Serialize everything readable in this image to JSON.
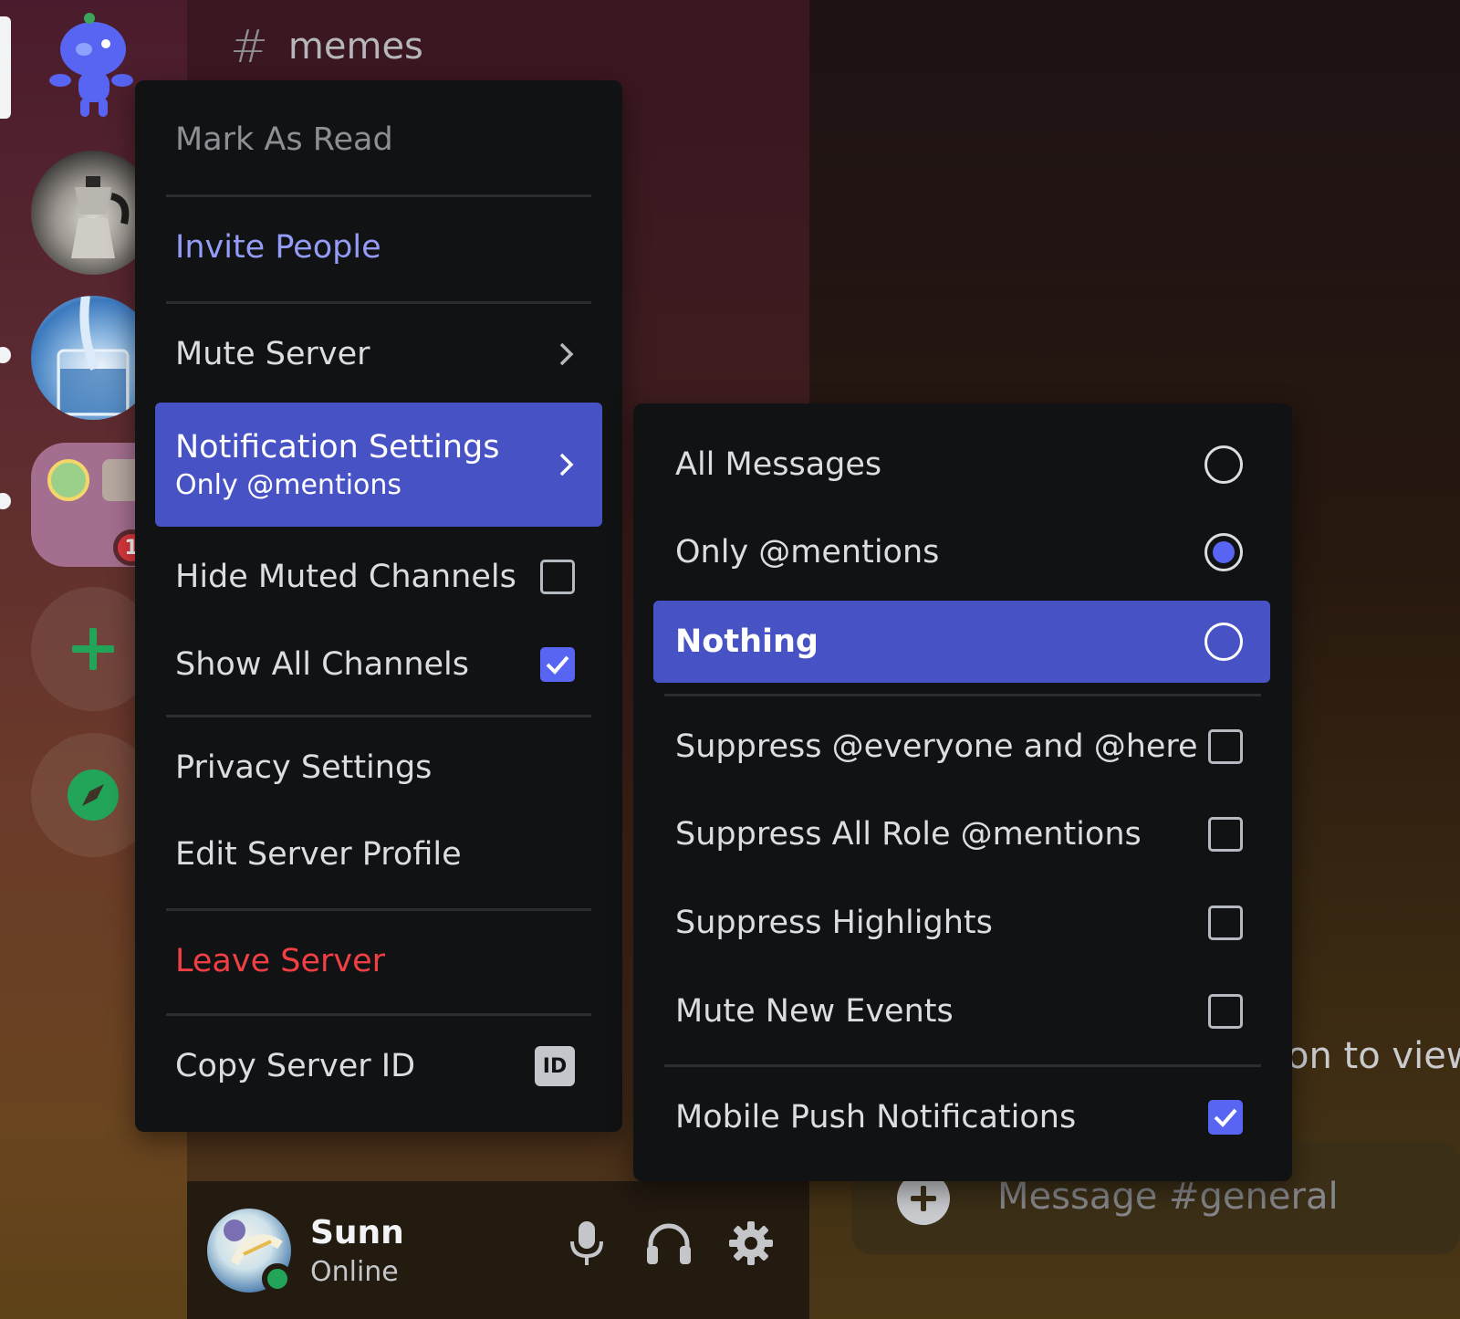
{
  "channel": {
    "hash": "#",
    "name": "memes"
  },
  "servers": {
    "folder_badge": "1"
  },
  "context_menu": {
    "mark_as_read": "Mark As Read",
    "invite_people": "Invite People",
    "mute_server": "Mute Server",
    "notification_settings": "Notification Settings",
    "notification_current": "Only @mentions",
    "hide_muted_channels": "Hide Muted Channels",
    "show_all_channels": "Show All Channels",
    "privacy_settings": "Privacy Settings",
    "edit_server_profile": "Edit Server Profile",
    "leave_server": "Leave Server",
    "copy_server_id": "Copy Server ID",
    "id_badge": "ID"
  },
  "notification_submenu": {
    "all_messages": "All Messages",
    "only_mentions": "Only @mentions",
    "nothing": "Nothing",
    "suppress_everyone": "Suppress @everyone and @here",
    "suppress_roles": "Suppress All Role @mentions",
    "suppress_highlights": "Suppress Highlights",
    "mute_new_events": "Mute New Events",
    "mobile_push": "Mobile Push Notifications"
  },
  "user": {
    "name": "Sunn",
    "status": "Online"
  },
  "chat": {
    "partial_text": "on to view",
    "message_placeholder": "Message #general"
  },
  "colors": {
    "accent": "#5865f2",
    "active_bg": "#4752c4",
    "danger": "#f23f43",
    "link": "#949cf7",
    "online": "#23a559"
  }
}
